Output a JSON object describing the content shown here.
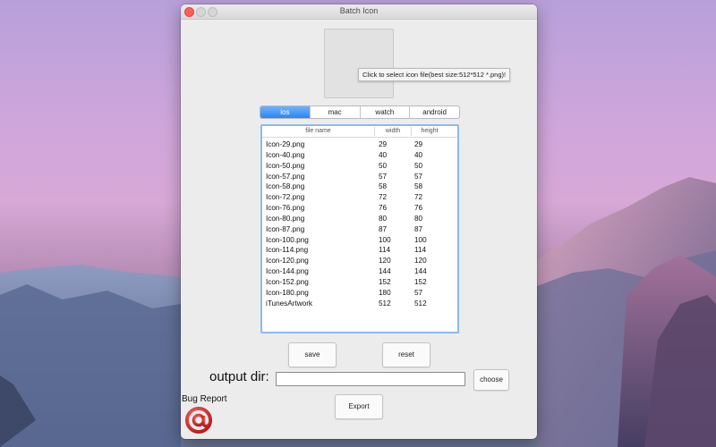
{
  "window": {
    "title": "Batch Icon"
  },
  "tooltip": {
    "text": "Click to select icon file(best size:512*512 *.png)!"
  },
  "tabs": [
    {
      "label": "ios",
      "active": true
    },
    {
      "label": "mac",
      "active": false
    },
    {
      "label": "watch",
      "active": false
    },
    {
      "label": "android",
      "active": false
    }
  ],
  "table": {
    "headers": [
      "file name",
      "width",
      "height"
    ],
    "rows": [
      [
        "Icon-29.png",
        "29",
        "29"
      ],
      [
        "Icon-40.png",
        "40",
        "40"
      ],
      [
        "Icon-50.png",
        "50",
        "50"
      ],
      [
        "Icon-57.png",
        "57",
        "57"
      ],
      [
        "Icon-58.png",
        "58",
        "58"
      ],
      [
        "Icon-72.png",
        "72",
        "72"
      ],
      [
        "Icon-76.png",
        "76",
        "76"
      ],
      [
        "Icon-80.png",
        "80",
        "80"
      ],
      [
        "Icon-87.png",
        "87",
        "87"
      ],
      [
        "Icon-100.png",
        "100",
        "100"
      ],
      [
        "Icon-114.png",
        "114",
        "114"
      ],
      [
        "Icon-120.png",
        "120",
        "120"
      ],
      [
        "Icon-144.png",
        "144",
        "144"
      ],
      [
        "Icon-152.png",
        "152",
        "152"
      ],
      [
        "Icon-180.png",
        "180",
        "57"
      ],
      [
        "iTunesArtwork",
        "512",
        "512"
      ]
    ]
  },
  "buttons": {
    "save": "save",
    "reset": "reset",
    "choose": "choose",
    "export": "Export"
  },
  "output": {
    "label": "output dir:",
    "value": ""
  },
  "bug_report": {
    "label": "Bug Report",
    "icon": "at-sign-icon"
  },
  "colors": {
    "accent": "#2d85f5",
    "close": "#fc5f57",
    "table_border": "#8fb8ea",
    "bug_icon": "#d42a2a"
  }
}
